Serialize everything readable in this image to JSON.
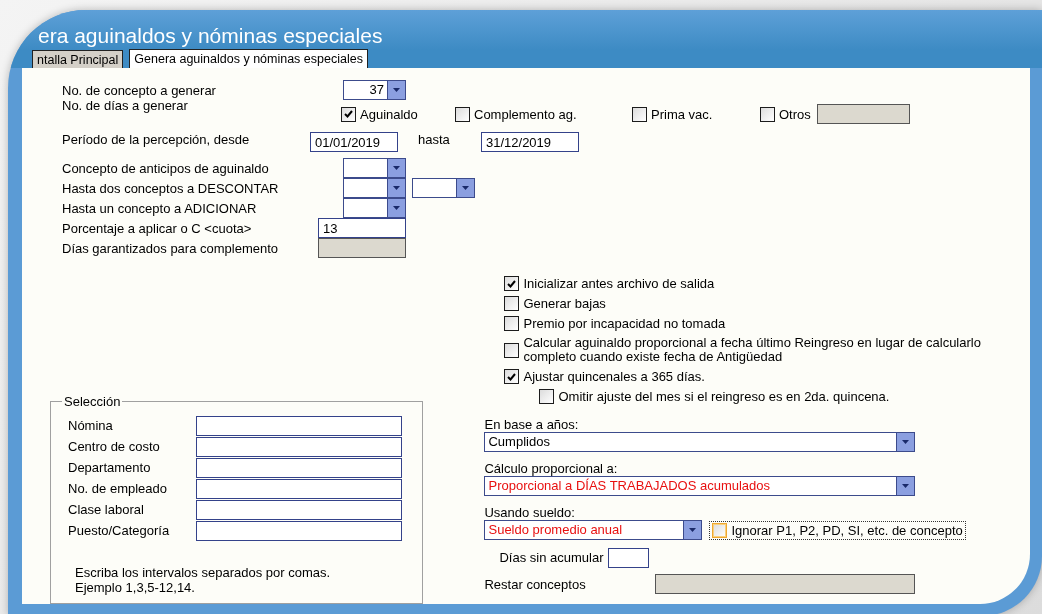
{
  "window": {
    "title": "era aguinaldos y nóminas especiales"
  },
  "tabs": [
    {
      "label": "ntalla Principal",
      "selected": false
    },
    {
      "label": "Genera aguinaldos y nóminas especiales",
      "selected": true
    }
  ],
  "concepto_a_generar": {
    "label": "No. de concepto a generar",
    "value": "37"
  },
  "dias_a_generar": {
    "label": "No. de días a generar",
    "options": [
      {
        "label": "Aguinaldo",
        "checked": true
      },
      {
        "label": "Complemento ag.",
        "checked": false
      },
      {
        "label": "Prima vac.",
        "checked": false
      },
      {
        "label": "Otros",
        "checked": false
      }
    ],
    "otros_field": {
      "disabled": true
    }
  },
  "periodo": {
    "label": "Período de la percepción, desde",
    "from": "01/01/2019",
    "to_label": "hasta",
    "to": "31/12/2019"
  },
  "concept_rows": [
    {
      "kind": "combo",
      "label": "Concepto de anticipos de aguinaldo"
    },
    {
      "kind": "two-combos",
      "label": "Hasta dos conceptos a DESCONTAR"
    },
    {
      "kind": "combo",
      "label": "Hasta un  concepto  a ADICIONAR"
    },
    {
      "kind": "text",
      "label": "Porcentaje a aplicar o C <cuota>",
      "value": "13",
      "disabled": false
    },
    {
      "kind": "text",
      "label": "Días garantizados para complemento",
      "disabled": true
    }
  ],
  "options": [
    {
      "label": "Inicializar antes archivo de salida",
      "checked": true
    },
    {
      "label": "Generar bajas",
      "checked": false
    },
    {
      "label": "Premio por incapacidad no tomada",
      "checked": false
    },
    {
      "label": "Calcular aguinaldo proporcional a fecha último Reingreso en lugar de calcularlo completo cuando existe fecha de Antigüedad",
      "checked": false
    },
    {
      "label": "Ajustar quincenales a 365 días.",
      "checked": true,
      "children": [
        {
          "label": "Omitir ajuste del mes si el reingreso es en 2da. quincena.",
          "checked": false
        }
      ]
    }
  ],
  "seleccion": {
    "title": "Selección",
    "fields": [
      {
        "label": "Nómina"
      },
      {
        "label": "Centro de costo"
      },
      {
        "label": "Departamento"
      },
      {
        "label": "No. de empleado"
      },
      {
        "label": "Clase laboral"
      },
      {
        "label": "Puesto/Categoría"
      }
    ],
    "note_lines": [
      "Escriba los intervalos separados por comas.",
      "Ejemplo 1,3,5-12,14."
    ]
  },
  "en_base": {
    "label": "En base a años:",
    "value": "Cumplidos",
    "emphasized": false
  },
  "calculo": {
    "label": "Cálculo proporcional  a:",
    "value": "Proporcional a DÍAS TRABAJADOS acumulados",
    "emphasized": true
  },
  "usando_sueldo": {
    "label": "Usando sueldo:",
    "value": "Sueldo promedio anual",
    "emphasized": true,
    "ignore_option": {
      "label": "Ignorar P1, P2, PD, SI, etc. de concepto",
      "checked": false,
      "focused": true
    }
  },
  "dias_sin_acumular": {
    "label": "Días sin acumular",
    "disabled": false
  },
  "restar_conceptos": {
    "label": "Restar conceptos",
    "disabled": true
  }
}
